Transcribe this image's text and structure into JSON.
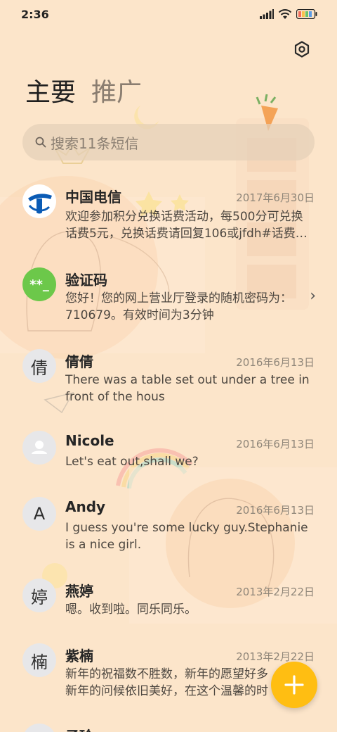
{
  "status_bar": {
    "time": "2:36"
  },
  "tabs": [
    {
      "label": "主要",
      "active": true
    },
    {
      "label": "推广",
      "active": false
    }
  ],
  "search": {
    "placeholder": "搜索11条短信"
  },
  "messages": [
    {
      "sender": "中国电信",
      "date": "2017年6月30日",
      "lines": [
        "欢迎参加积分兑换话费活动，每500分可兑换",
        "话费5元，兑换话费请回复106或jfdh#话费…"
      ],
      "avatar": "china-telecom-logo"
    },
    {
      "sender": "验证码",
      "date": "",
      "lines": [
        "您好！您的网上营业厅登录的随机密码为：",
        "710679。有效时间为3分钟"
      ],
      "avatar": "verification-code-icon",
      "avatar_text": "**_"
    },
    {
      "sender": "倩倩",
      "date": "2016年6月13日",
      "lines": [
        "There was a table set out under a tree in",
        "front of the hous"
      ],
      "avatar_text": "倩"
    },
    {
      "sender": "Nicole",
      "date": "2016年6月13日",
      "lines": [
        "Let's eat out,shall we?"
      ],
      "avatar": "person-icon"
    },
    {
      "sender": "Andy",
      "date": "2016年6月13日",
      "lines": [
        "I guess you're some lucky guy.Stephanie",
        "is a nice girl."
      ],
      "avatar_text": "A"
    },
    {
      "sender": "燕婷",
      "date": "2013年2月22日",
      "lines": [
        "嗯。收到啦。同乐同乐。"
      ],
      "avatar_text": "婷"
    },
    {
      "sender": "紫楠",
      "date": "2013年2月22日",
      "lines": [
        "新年的祝福数不胜数，新年的愿望好多",
        "新年的问候依旧美好，在这个温馨的时"
      ],
      "avatar_text": "楠"
    },
    {
      "sender": "子玲",
      "date": "",
      "lines": [],
      "avatar_text": ""
    }
  ],
  "icons": {
    "settings": "settings-icon",
    "search": "search-icon",
    "chevron": "chevron-right-icon",
    "fab": "plus-icon"
  },
  "colors": {
    "background": "#fce5ca",
    "fab": "#ffbe12",
    "verification": "#6cc84a",
    "telecom": "#0a5bb5"
  }
}
